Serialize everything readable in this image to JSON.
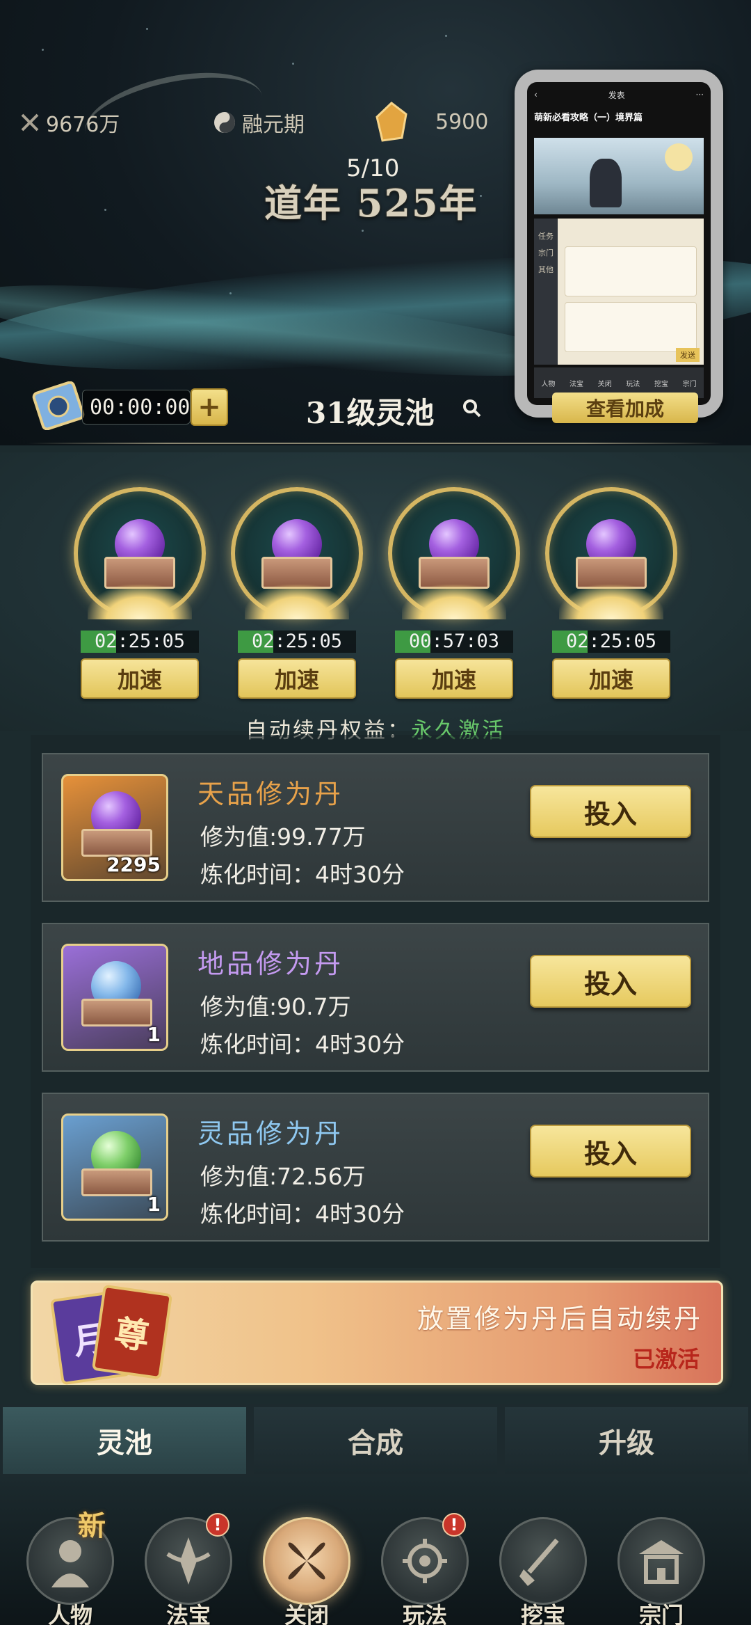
{
  "status_bar": {
    "power_value": "9676万",
    "realm": "融元期",
    "gem_count": "5900"
  },
  "header": {
    "page_counter": "5/10",
    "dao_year": "道年 525年"
  },
  "mini_window": {
    "top_label": "发表",
    "article_title": "萌新必看攻略（一）境界篇",
    "side_items": [
      "任务",
      "宗门",
      "其他"
    ],
    "send_label": "发送",
    "tabs": [
      "人物",
      "法宝",
      "关闭",
      "玩法",
      "挖宝",
      "宗门"
    ]
  },
  "pool": {
    "timer": "00:00:00",
    "add_label": "+",
    "title": "31级灵池",
    "view_bonus_label": "查看加成"
  },
  "slots": [
    {
      "timer": "02:25:05",
      "speed_label": "加速",
      "progress": 0.3
    },
    {
      "timer": "02:25:05",
      "speed_label": "加速",
      "progress": 0.3
    },
    {
      "timer": "00:57:03",
      "speed_label": "加速",
      "progress": 0.3
    },
    {
      "timer": "02:25:05",
      "speed_label": "加速",
      "progress": 0.3
    }
  ],
  "auto_renew": {
    "label": "自动续丹权益：",
    "status": "永久激活"
  },
  "pills": [
    {
      "name": "天品修为丹",
      "value": "修为值:99.77万",
      "time": "炼化时间：4时30分",
      "qty": "2295",
      "button": "投入",
      "name_color": "#e8a24a",
      "frame_color": "#e6913a",
      "orb_color": "purple"
    },
    {
      "name": "地品修为丹",
      "value": "修为值:90.7万",
      "time": "炼化时间：4时30分",
      "qty": "1",
      "button": "投入",
      "name_color": "#c49af0",
      "frame_color": "#9a6fd8",
      "orb_color": "blue"
    },
    {
      "name": "灵品修为丹",
      "value": "修为值:72.56万",
      "time": "炼化时间：4时30分",
      "qty": "1",
      "button": "投入",
      "name_color": "#8fc8f0",
      "frame_color": "#6a9fd0",
      "orb_color": "green"
    }
  ],
  "banner": {
    "text": "放置修为丹后自动续丹",
    "status": "已激活",
    "card_left": "月",
    "card_right": "尊"
  },
  "tabs": [
    "灵池",
    "合成",
    "升级"
  ],
  "nav": [
    {
      "label": "人物",
      "badge": "新",
      "icon": "character-icon"
    },
    {
      "label": "法宝",
      "badge": "!",
      "icon": "treasure-icon"
    },
    {
      "label": "关闭",
      "badge": "",
      "icon": "close-icon"
    },
    {
      "label": "玩法",
      "badge": "!",
      "icon": "gameplay-icon"
    },
    {
      "label": "挖宝",
      "badge": "",
      "icon": "shovel-icon"
    },
    {
      "label": "宗门",
      "badge": "",
      "icon": "sect-icon"
    }
  ]
}
